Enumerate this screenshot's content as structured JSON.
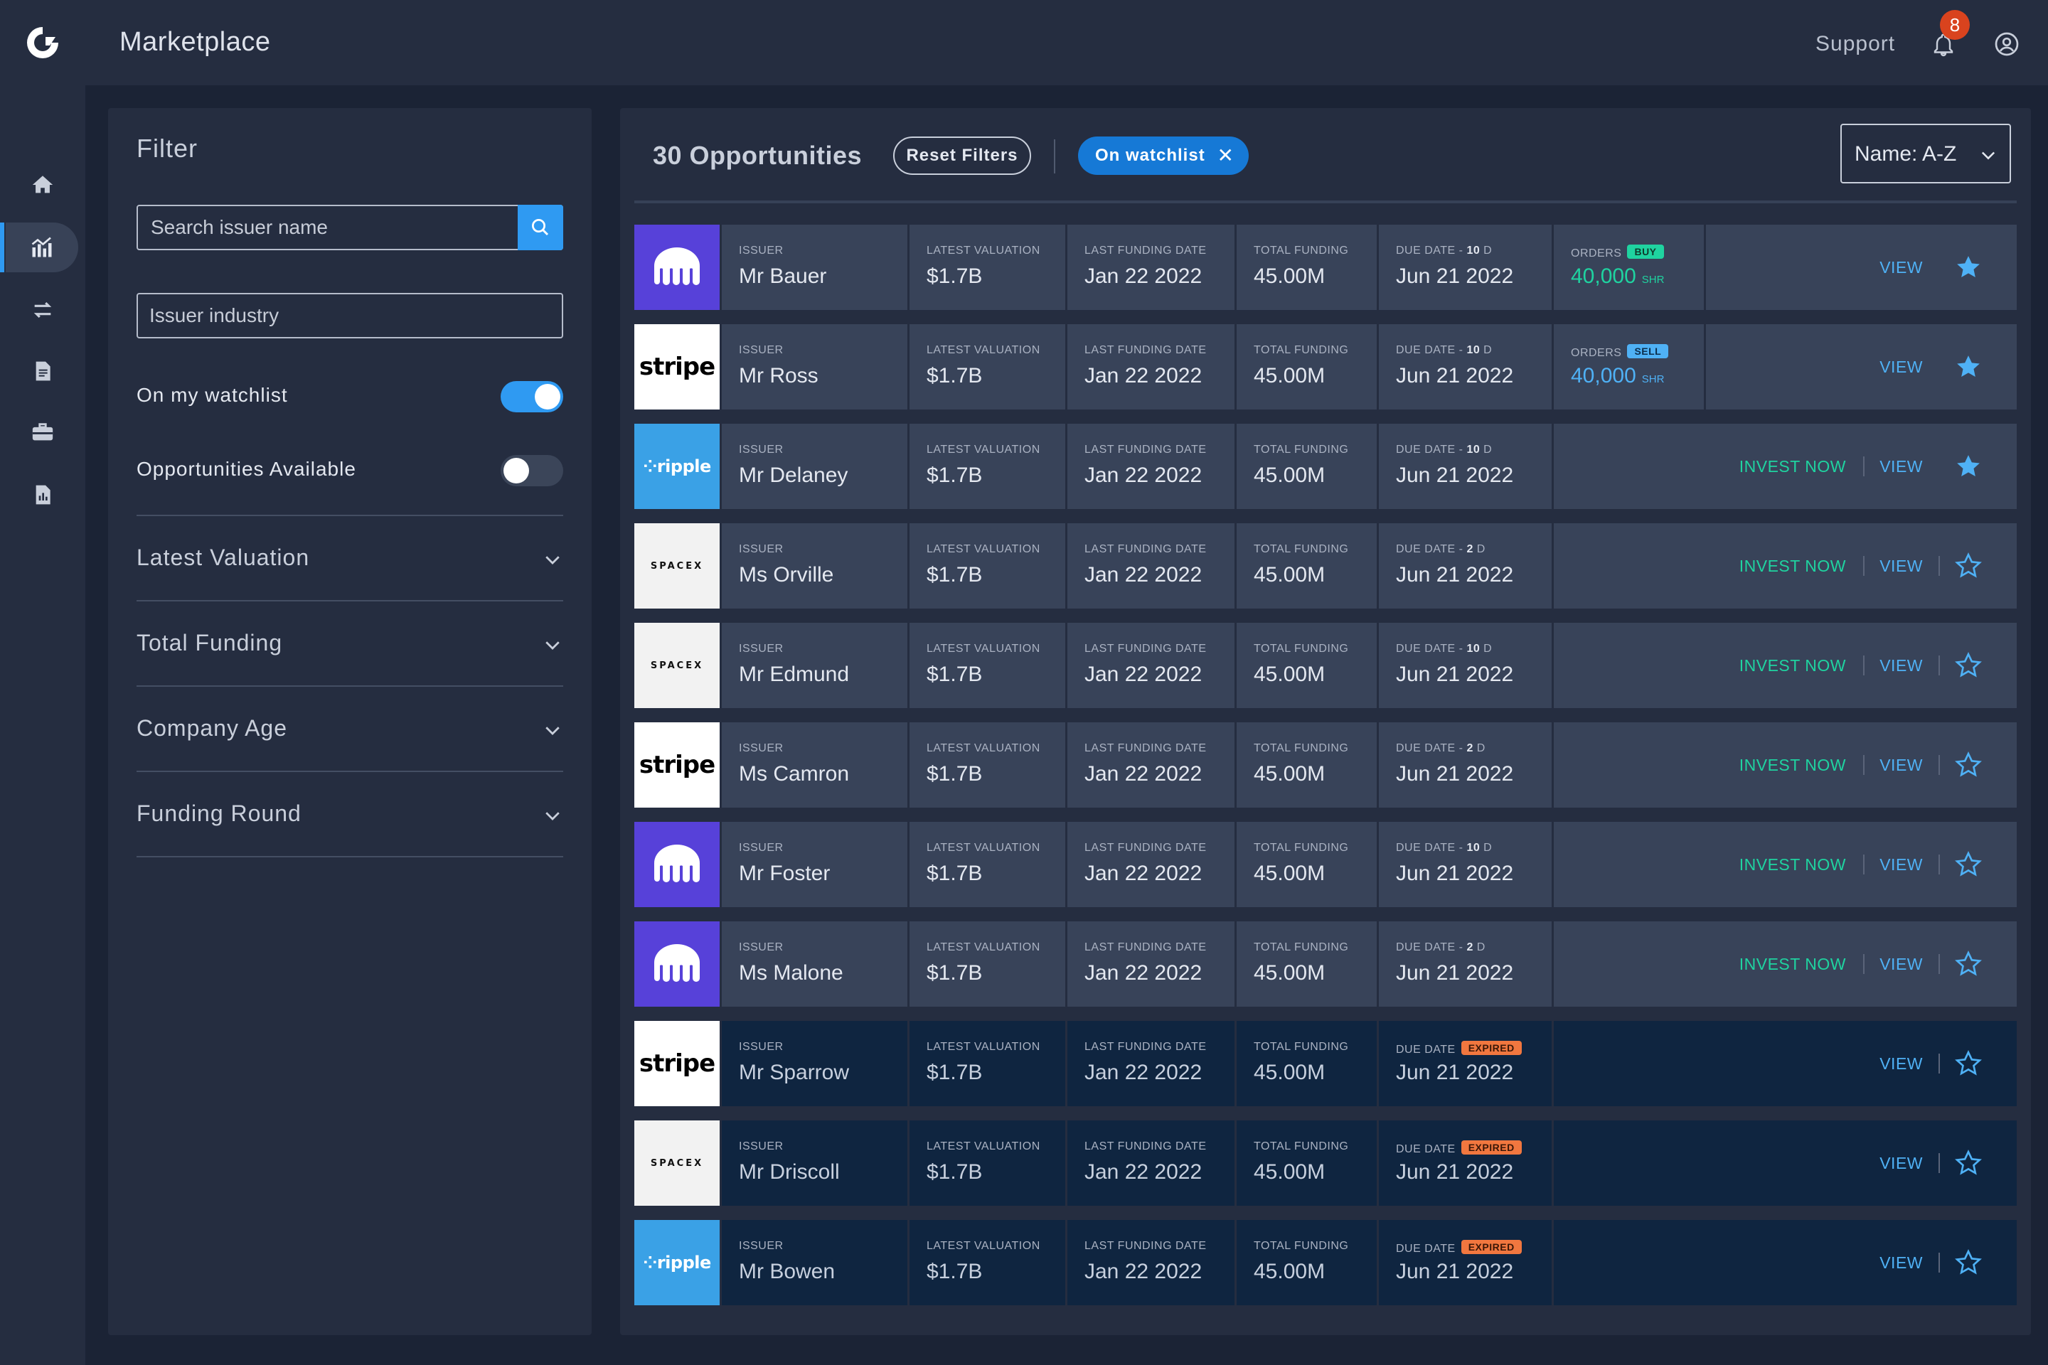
{
  "app": {
    "title": "Marketplace"
  },
  "topbar": {
    "support": "Support",
    "notifications": "8"
  },
  "filter": {
    "title": "Filter",
    "search_placeholder": "Search issuer name",
    "industry_placeholder": "Issuer industry",
    "watchlist_label": "On my watchlist",
    "watchlist_on": true,
    "available_label": "Opportunities Available",
    "available_on": false,
    "sections": [
      "Latest Valuation",
      "Total Funding",
      "Company Age",
      "Funding Round"
    ]
  },
  "main": {
    "count": "30 Opportunities",
    "reset": "Reset Filters",
    "chip": "On watchlist",
    "sort": "Name: A-Z"
  },
  "labels": {
    "issuer": "ISSUER",
    "valuation": "LATEST VALUATION",
    "funding_date": "LAST FUNDING DATE",
    "total": "TOTAL FUNDING",
    "due": "DUE DATE",
    "orders": "ORDERS",
    "shr": "SHR",
    "invest": "INVEST NOW",
    "view": "VIEW",
    "expired": "EXPIRED",
    "buy": "BUY",
    "sell": "SELL"
  },
  "colors": {
    "accent": "#2f9af2",
    "green": "#1fd3a0",
    "blue": "#4fb1f5",
    "expired": "#f1773f",
    "kraken": "#5741d9",
    "ripple": "#3aa1e6"
  },
  "rows": [
    {
      "logo": "kraken",
      "issuer": "Mr Bauer",
      "valuation": "$1.7B",
      "funding_date": "Jan 22 2022",
      "total": "45.00M",
      "due_suffix": "10",
      "due": "Jun 21 2022",
      "orders": "40,000",
      "order_type": "buy",
      "invest": false,
      "starred": true,
      "expired": false
    },
    {
      "logo": "stripe",
      "issuer": "Mr Ross",
      "valuation": "$1.7B",
      "funding_date": "Jan 22 2022",
      "total": "45.00M",
      "due_suffix": "10",
      "due": "Jun 21 2022",
      "orders": "40,000",
      "order_type": "sell",
      "invest": false,
      "starred": true,
      "expired": false
    },
    {
      "logo": "ripple",
      "issuer": "Mr Delaney",
      "valuation": "$1.7B",
      "funding_date": "Jan 22 2022",
      "total": "45.00M",
      "due_suffix": "10",
      "due": "Jun 21 2022",
      "orders": "",
      "order_type": "",
      "invest": true,
      "starred": true,
      "expired": false
    },
    {
      "logo": "spacex",
      "issuer": "Ms Orville",
      "valuation": "$1.7B",
      "funding_date": "Jan 22 2022",
      "total": "45.00M",
      "due_suffix": "2",
      "due": "Jun 21 2022",
      "orders": "",
      "order_type": "",
      "invest": true,
      "starred": false,
      "expired": false
    },
    {
      "logo": "spacex",
      "issuer": "Mr Edmund",
      "valuation": "$1.7B",
      "funding_date": "Jan 22 2022",
      "total": "45.00M",
      "due_suffix": "10",
      "due": "Jun 21 2022",
      "orders": "",
      "order_type": "",
      "invest": true,
      "starred": false,
      "expired": false
    },
    {
      "logo": "stripe",
      "issuer": "Ms Camron",
      "valuation": "$1.7B",
      "funding_date": "Jan 22 2022",
      "total": "45.00M",
      "due_suffix": "2",
      "due": "Jun 21 2022",
      "orders": "",
      "order_type": "",
      "invest": true,
      "starred": false,
      "expired": false
    },
    {
      "logo": "kraken",
      "issuer": "Mr Foster",
      "valuation": "$1.7B",
      "funding_date": "Jan 22 2022",
      "total": "45.00M",
      "due_suffix": "10",
      "due": "Jun 21 2022",
      "orders": "",
      "order_type": "",
      "invest": true,
      "starred": false,
      "expired": false
    },
    {
      "logo": "kraken",
      "issuer": "Ms Malone",
      "valuation": "$1.7B",
      "funding_date": "Jan 22 2022",
      "total": "45.00M",
      "due_suffix": "2",
      "due": "Jun 21 2022",
      "orders": "",
      "order_type": "",
      "invest": true,
      "starred": false,
      "expired": false
    },
    {
      "logo": "stripe",
      "issuer": "Mr Sparrow",
      "valuation": "$1.7B",
      "funding_date": "Jan 22 2022",
      "total": "45.00M",
      "due_suffix": "",
      "due": "Jun 21 2022",
      "orders": "",
      "order_type": "",
      "invest": false,
      "starred": false,
      "expired": true
    },
    {
      "logo": "spacex",
      "issuer": "Mr Driscoll",
      "valuation": "$1.7B",
      "funding_date": "Jan 22 2022",
      "total": "45.00M",
      "due_suffix": "",
      "due": "Jun 21 2022",
      "orders": "",
      "order_type": "",
      "invest": false,
      "starred": false,
      "expired": true
    },
    {
      "logo": "ripple",
      "issuer": "Mr Bowen",
      "valuation": "$1.7B",
      "funding_date": "Jan 22 2022",
      "total": "45.00M",
      "due_suffix": "",
      "due": "Jun 21 2022",
      "orders": "",
      "order_type": "",
      "invest": false,
      "starred": false,
      "expired": true
    }
  ],
  "logos": {
    "stripe": "stripe",
    "ripple": "ripple",
    "spacex": "SPACEX"
  }
}
